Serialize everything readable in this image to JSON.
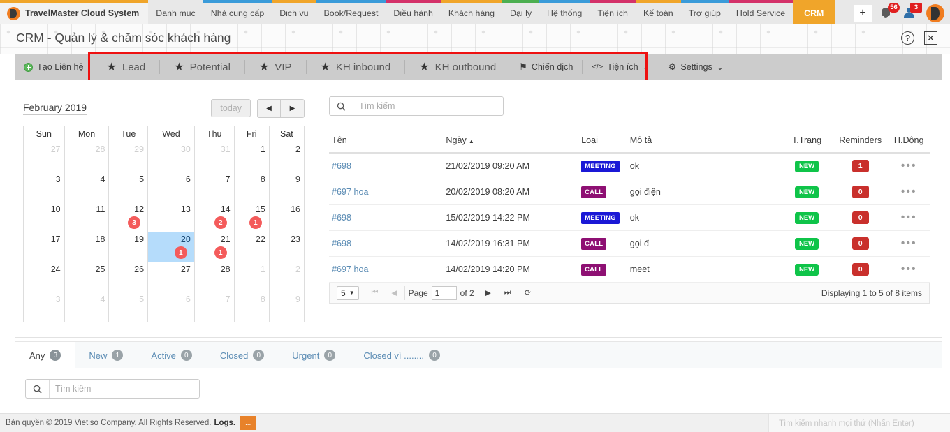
{
  "topnav": {
    "brand": "TravelMaster Cloud System",
    "items": [
      {
        "label": "Danh mục",
        "strip": "#e8e8e8"
      },
      {
        "label": "Nhà cung cấp",
        "strip": "#3a9bd9"
      },
      {
        "label": "Dịch vụ",
        "strip": "#f0a52a"
      },
      {
        "label": "Book/Request",
        "strip": "#3a9bd9"
      },
      {
        "label": "Điều hành",
        "strip": "#d4326a"
      },
      {
        "label": "Khách hàng",
        "strip": "#f0a52a"
      },
      {
        "label": "Đại lý",
        "strip": "#4caf50"
      },
      {
        "label": "Hệ thống",
        "strip": "#3a9bd9"
      },
      {
        "label": "Tiện ích",
        "strip": "#d4326a"
      },
      {
        "label": "Kế toán",
        "strip": "#f0a52a"
      },
      {
        "label": "Trợ giúp",
        "strip": "#3a9bd9"
      },
      {
        "label": "Hold Service",
        "strip": "#d4326a"
      },
      {
        "label": "CRM",
        "strip": "#f0a52a"
      }
    ],
    "add_label": "+",
    "notifications_count": "56",
    "users_count": "3"
  },
  "titlebar": {
    "title": "CRM - Quản lý & chăm sóc khách hàng",
    "help_label": "?",
    "close_label": "✕"
  },
  "toolbar": {
    "create_contact": "Tạo Liên hệ",
    "star_tabs": [
      {
        "label": "Lead"
      },
      {
        "label": "Potential"
      },
      {
        "label": "VIP"
      },
      {
        "label": "KH inbound"
      },
      {
        "label": "KH outbound"
      }
    ],
    "right_items": [
      {
        "label": "Chiến dịch",
        "icon": "flag-icon",
        "caret": false
      },
      {
        "label": "Tiện ích",
        "icon": "code-icon",
        "caret": true
      },
      {
        "label": "Settings",
        "icon": "gear-icon",
        "caret": true
      }
    ]
  },
  "calendar": {
    "month_label": "February 2019",
    "today_label": "today",
    "prev_label": "◀",
    "next_label": "▶",
    "weekdays": [
      "Sun",
      "Mon",
      "Tue",
      "Wed",
      "Thu",
      "Fri",
      "Sat"
    ],
    "weeks": [
      [
        {
          "d": "27",
          "other": true
        },
        {
          "d": "28",
          "other": true
        },
        {
          "d": "29",
          "other": true
        },
        {
          "d": "30",
          "other": true
        },
        {
          "d": "31",
          "other": true
        },
        {
          "d": "1"
        },
        {
          "d": "2"
        }
      ],
      [
        {
          "d": "3"
        },
        {
          "d": "4"
        },
        {
          "d": "5"
        },
        {
          "d": "6"
        },
        {
          "d": "7"
        },
        {
          "d": "8"
        },
        {
          "d": "9"
        }
      ],
      [
        {
          "d": "10"
        },
        {
          "d": "11"
        },
        {
          "d": "12",
          "badge": "3"
        },
        {
          "d": "13"
        },
        {
          "d": "14",
          "badge": "2"
        },
        {
          "d": "15",
          "badge": "1"
        },
        {
          "d": "16"
        }
      ],
      [
        {
          "d": "17"
        },
        {
          "d": "18"
        },
        {
          "d": "19"
        },
        {
          "d": "20",
          "badge": "1",
          "selected": true
        },
        {
          "d": "21",
          "badge": "1"
        },
        {
          "d": "22"
        },
        {
          "d": "23"
        }
      ],
      [
        {
          "d": "24"
        },
        {
          "d": "25"
        },
        {
          "d": "26"
        },
        {
          "d": "27"
        },
        {
          "d": "28"
        },
        {
          "d": "1",
          "other": true
        },
        {
          "d": "2",
          "other": true
        }
      ],
      [
        {
          "d": "3",
          "other": true
        },
        {
          "d": "4",
          "other": true
        },
        {
          "d": "5",
          "other": true
        },
        {
          "d": "6",
          "other": true
        },
        {
          "d": "7",
          "other": true
        },
        {
          "d": "8",
          "other": true
        },
        {
          "d": "9",
          "other": true
        }
      ]
    ]
  },
  "activity": {
    "search_placeholder": "Tìm kiếm",
    "columns": [
      "Tên",
      "Ngày",
      "Loại",
      "Mô tả",
      "T.Trạng",
      "Reminders",
      "H.Động"
    ],
    "sort_column": "Ngày",
    "sort_dir": "▲",
    "rows": [
      {
        "name": "#698",
        "date": "21/02/2019 09:20 AM",
        "type": "MEETING",
        "desc": "ok",
        "status": "NEW",
        "reminders": "1",
        "action": "•••"
      },
      {
        "name": "#697 hoa",
        "date": "20/02/2019 08:20 AM",
        "type": "CALL",
        "desc": "gọi điện",
        "status": "NEW",
        "reminders": "0",
        "action": "•••"
      },
      {
        "name": "#698",
        "date": "15/02/2019 14:22 PM",
        "type": "MEETING",
        "desc": "ok",
        "status": "NEW",
        "reminders": "0",
        "action": "•••"
      },
      {
        "name": "#698",
        "date": "14/02/2019 16:31 PM",
        "type": "CALL",
        "desc": "gọi đ",
        "status": "NEW",
        "reminders": "0",
        "action": "•••"
      },
      {
        "name": "#697 hoa",
        "date": "14/02/2019 14:20 PM",
        "type": "CALL",
        "desc": "meet",
        "status": "NEW",
        "reminders": "0",
        "action": "•••"
      }
    ],
    "pager": {
      "page_size": "5",
      "first": "⏮",
      "prev": "◀",
      "page_label": "Page",
      "page_value": "1",
      "of_label": "of 2",
      "next": "▶",
      "last": "⏭",
      "refresh": "⟳",
      "display": "Displaying 1 to 5 of 8 items"
    }
  },
  "bottom": {
    "tabs": [
      {
        "label": "Any",
        "count": "3",
        "active": true
      },
      {
        "label": "New",
        "count": "1",
        "active": false
      },
      {
        "label": "Active",
        "count": "0",
        "active": false
      },
      {
        "label": "Closed",
        "count": "0",
        "active": false
      },
      {
        "label": "Urgent",
        "count": "0",
        "active": false
      },
      {
        "label": "Closed vì ........",
        "count": "0",
        "active": false
      }
    ],
    "search_placeholder": "Tìm kiếm"
  },
  "footer": {
    "copyright": "Bản quyền © 2019 Vietiso Company. All Rights Reserved.",
    "logs_label": "Logs.",
    "quick_search_placeholder": "Tìm kiếm nhanh mọi thứ (Nhấn Enter)"
  },
  "colors": {
    "accent_orange": "#f0a52a",
    "badge_red": "#e02020",
    "status_green": "#0fc449",
    "meeting_blue": "#1a18d6",
    "call_purple": "#8e1073",
    "annotation_red": "#ee1111"
  }
}
